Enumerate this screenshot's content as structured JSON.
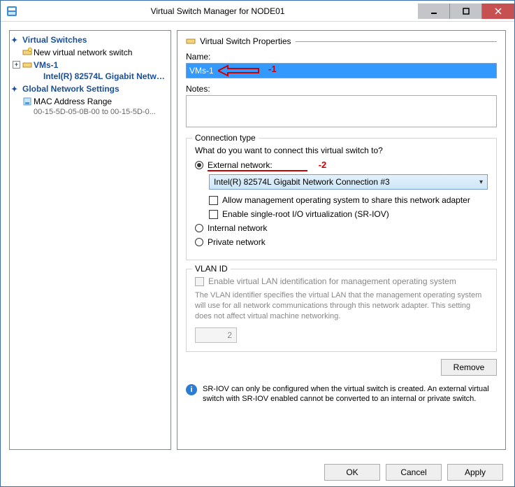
{
  "titlebar": {
    "title": "Virtual Switch Manager for NODE01"
  },
  "tree": {
    "section1": "Virtual Switches",
    "new_switch": "New virtual network switch",
    "vm_switch": "VMs-1",
    "vm_adapter": "Intel(R) 82574L Gigabit Netwo...",
    "section2": "Global Network Settings",
    "mac_label": "MAC Address Range",
    "mac_range": "00-15-5D-05-0B-00 to 00-15-5D-0..."
  },
  "panel": {
    "header": "Virtual Switch Properties",
    "name_label": "Name:",
    "name_value": "VMs-1",
    "notes_label": "Notes:",
    "conn_group": "Connection type",
    "conn_question": "What do you want to connect this virtual switch to?",
    "external_label": "External network:",
    "adapter_selected": "Intel(R) 82574L Gigabit Network Connection #3",
    "allow_mgmt": "Allow management operating system to share this network adapter",
    "sriov": "Enable single-root I/O virtualization (SR-IOV)",
    "internal_label": "Internal network",
    "private_label": "Private network",
    "vlan_group": "VLAN ID",
    "vlan_enable": "Enable virtual LAN identification for management operating system",
    "vlan_help": "The VLAN identifier specifies the virtual LAN that the management operating system will use for all network communications through this network adapter. This setting does not affect virtual machine networking.",
    "vlan_value": "2",
    "remove": "Remove",
    "info": "SR-IOV can only be configured when the virtual switch is created. An external virtual switch with SR-IOV enabled cannot be converted to an internal or private switch."
  },
  "buttons": {
    "ok": "OK",
    "cancel": "Cancel",
    "apply": "Apply"
  },
  "annotations": {
    "a1": "-1",
    "a2": "-2"
  }
}
